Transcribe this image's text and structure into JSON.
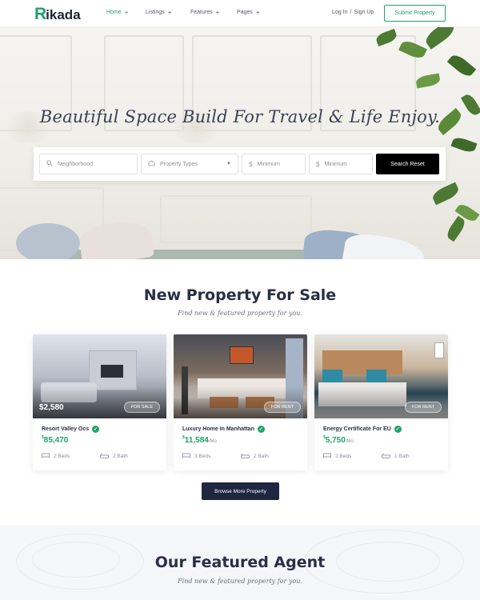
{
  "brand": {
    "logo_letter": "R",
    "logo_rest": "ikada"
  },
  "nav": {
    "items": [
      {
        "label": "Home",
        "active": true
      },
      {
        "label": "Listings"
      },
      {
        "label": "Features"
      },
      {
        "label": "Pages"
      }
    ],
    "expand_symbol": "+",
    "login": "Log In",
    "separator": "/",
    "signup": "Sign Up",
    "submit_label": "Submit Property"
  },
  "hero": {
    "title": "Beautiful Space Build For Travel & Life Enjoy.",
    "search": {
      "neighborhood_placeholder": "Neighborhood",
      "property_types_placeholder": "Property Types",
      "min_price_placeholder": "Minimum",
      "max_price_placeholder": "Minimum",
      "currency_symbol": "$",
      "button_label": "Search Reset"
    }
  },
  "sale_section": {
    "title": "New Property For Sale",
    "subtitle": "Find new & featured property for you.",
    "cards": [
      {
        "overlay_price": "$2,580",
        "tag": "FOR SALE",
        "name": "Resort Valley Ocs",
        "price_symbol": "$",
        "price": "85,470",
        "period": "",
        "beds": "2 Beds",
        "baths": "2 Bath"
      },
      {
        "overlay_price": "",
        "tag": "FOR RENT",
        "name": "Luxury Home In Manhattan",
        "price_symbol": "$",
        "price": "11,584",
        "period": "/Mo",
        "beds": "3 Beds",
        "baths": "2 Bath"
      },
      {
        "overlay_price": "",
        "tag": "FOR RENT",
        "name": "Energy Certificate For EU",
        "price_symbol": "$",
        "price": "5,750",
        "period": "/Mo",
        "beds": "2 Beds",
        "baths": "1 Bath"
      }
    ],
    "browse_label": "Browse More Property"
  },
  "agent_section": {
    "title": "Our Featured Agent",
    "subtitle": "Find new & featured property for you."
  },
  "colors": {
    "accent": "#1fa36a",
    "dark": "#1e2640"
  }
}
